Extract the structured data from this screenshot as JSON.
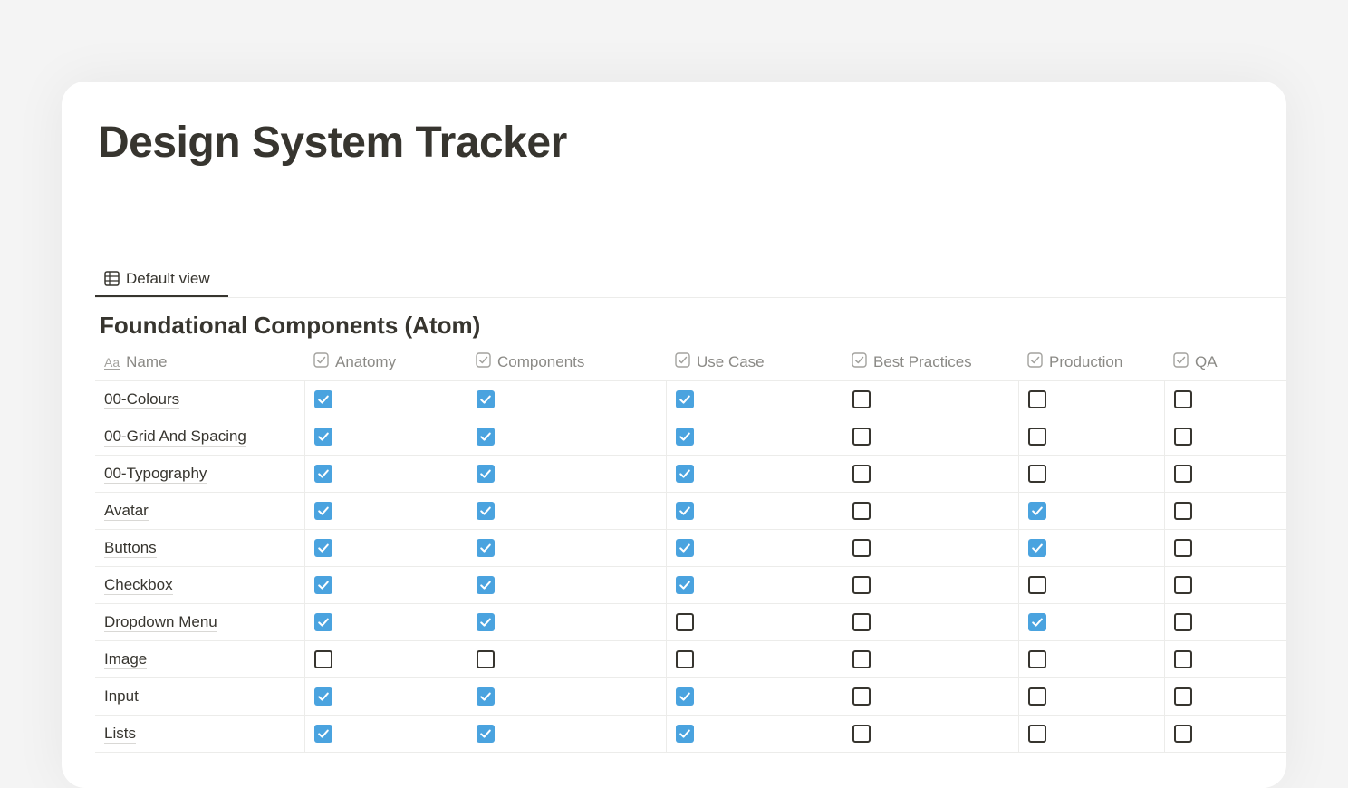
{
  "page": {
    "title": "Design System Tracker",
    "view_tab": {
      "label": "Default view",
      "icon": "table-icon"
    },
    "section_title": "Foundational Components (Atom)"
  },
  "table": {
    "name_column": {
      "prefix": "Aa",
      "label": "Name"
    },
    "columns": [
      "Anatomy",
      "Components",
      "Use Case",
      "Best Practices",
      "Production",
      "QA"
    ],
    "rows": [
      {
        "name": "00-Colours",
        "checks": [
          true,
          true,
          true,
          false,
          false,
          false
        ]
      },
      {
        "name": "00-Grid And Spacing",
        "checks": [
          true,
          true,
          true,
          false,
          false,
          false
        ]
      },
      {
        "name": "00-Typography",
        "checks": [
          true,
          true,
          true,
          false,
          false,
          false
        ]
      },
      {
        "name": "Avatar",
        "checks": [
          true,
          true,
          true,
          false,
          true,
          false
        ]
      },
      {
        "name": "Buttons",
        "checks": [
          true,
          true,
          true,
          false,
          true,
          false
        ]
      },
      {
        "name": "Checkbox",
        "checks": [
          true,
          true,
          true,
          false,
          false,
          false
        ]
      },
      {
        "name": "Dropdown Menu",
        "checks": [
          true,
          true,
          false,
          false,
          true,
          false
        ]
      },
      {
        "name": "Image",
        "checks": [
          false,
          false,
          false,
          false,
          false,
          false
        ]
      },
      {
        "name": "Input",
        "checks": [
          true,
          true,
          true,
          false,
          false,
          false
        ]
      },
      {
        "name": "Lists",
        "checks": [
          true,
          true,
          true,
          false,
          false,
          false
        ]
      }
    ]
  },
  "colors": {
    "checked": "#4aa3df",
    "text": "#37352f",
    "muted": "#8b8a86"
  }
}
